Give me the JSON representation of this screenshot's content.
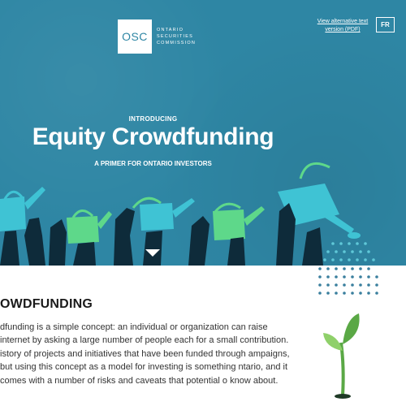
{
  "header": {
    "logo_abbr": "OSC",
    "logo_words": [
      "ONTARIO",
      "SECURITIES",
      "COMMISSION"
    ],
    "alt_link": "View alternative text version (PDF)",
    "language_button": "FR"
  },
  "hero": {
    "intro": "INTRODUCING",
    "title": "Equity Crowdfunding",
    "subtitle": "A PRIMER FOR ONTARIO INVESTORS"
  },
  "section": {
    "title": "OWDFUNDING",
    "paragraph": "dfunding is a simple concept: an individual or organization can raise internet by asking a large number of people each for a small contribution. istory of projects and initiatives that have been funded through ampaigns, but using this concept as a model for investing is something ntario, and it comes with a number of risks and caveats that potential o know about."
  },
  "colors": {
    "hero_bg": "#2e86a4",
    "can_cyan": "#3fc3d4",
    "can_green": "#5ed88a",
    "arm_dark": "#0e2b3a",
    "sprout_green": "#5aa845"
  },
  "icons": [
    "watering-cans-illustration",
    "down-arrow-icon",
    "sprout-icon"
  ]
}
